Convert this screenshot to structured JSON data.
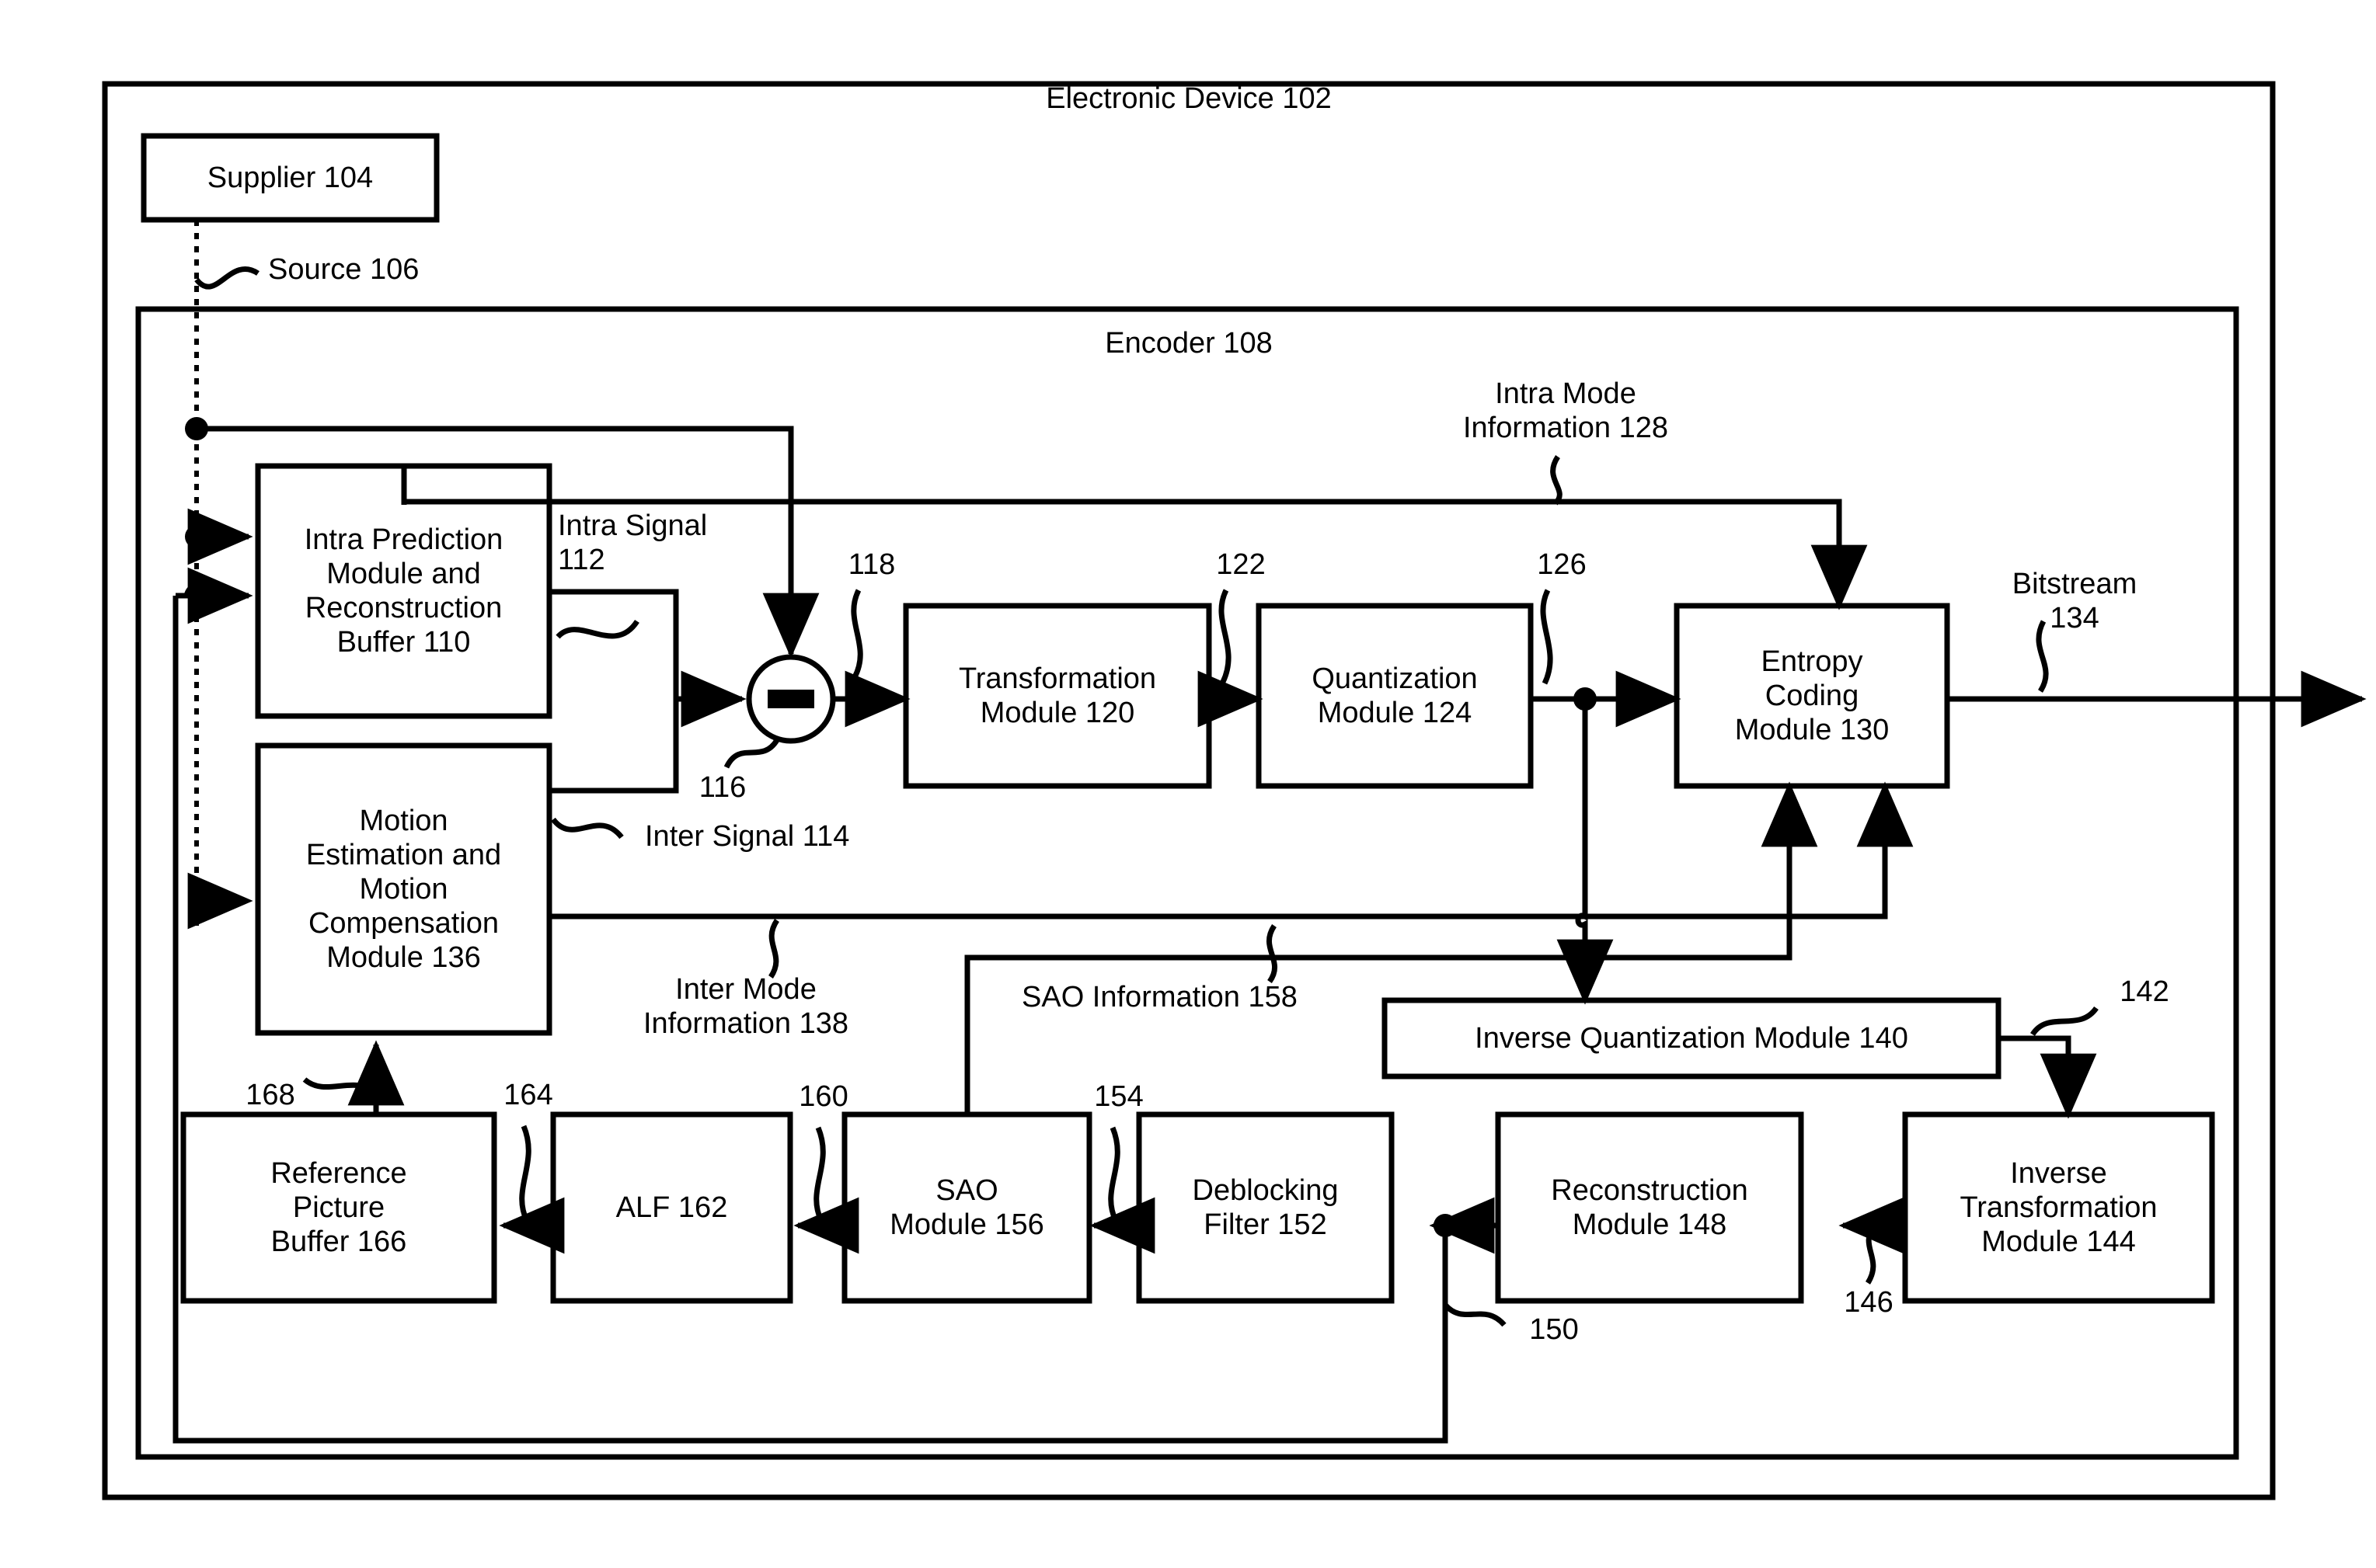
{
  "figure": {
    "outer_title": "Electronic Device 102",
    "encoder_title": "Encoder 108"
  },
  "boxes": {
    "supplier": "Supplier 104",
    "intra_prediction": "Intra Prediction\nModule and\nReconstruction\nBuffer 110",
    "motion_estimation": "Motion\nEstimation and\nMotion\nCompensation\nModule 136",
    "transformation": "Transformation\nModule 120",
    "quantization": "Quantization\nModule 124",
    "entropy_coding": "Entropy\nCoding\nModule 130",
    "inverse_quantization": "Inverse Quantization Module 140",
    "inverse_transformation": "Inverse\nTransformation\nModule 144",
    "reconstruction": "Reconstruction\nModule 148",
    "deblocking_filter": "Deblocking\nFilter 152",
    "sao_module": "SAO\nModule 156",
    "alf": "ALF 162",
    "reference_picture_buffer": "Reference\nPicture\nBuffer 166"
  },
  "signal_labels": {
    "source": "Source 106",
    "intra_signal": "Intra Signal\n112",
    "inter_signal": "Inter Signal 114",
    "intra_mode_information": "Intra Mode\nInformation 128",
    "inter_mode_information": "Inter Mode\nInformation 138",
    "sao_information": "SAO Information 158",
    "bitstream": "Bitstream\n134"
  },
  "reference_numerals": {
    "n116": "116",
    "n118": "118",
    "n122": "122",
    "n126": "126",
    "n142": "142",
    "n146": "146",
    "n150": "150",
    "n154": "154",
    "n160": "160",
    "n164": "164",
    "n168": "168"
  },
  "operator": {
    "subtract_symbol": "−"
  },
  "colors": {
    "stroke": "#000000",
    "background": "#ffffff"
  }
}
